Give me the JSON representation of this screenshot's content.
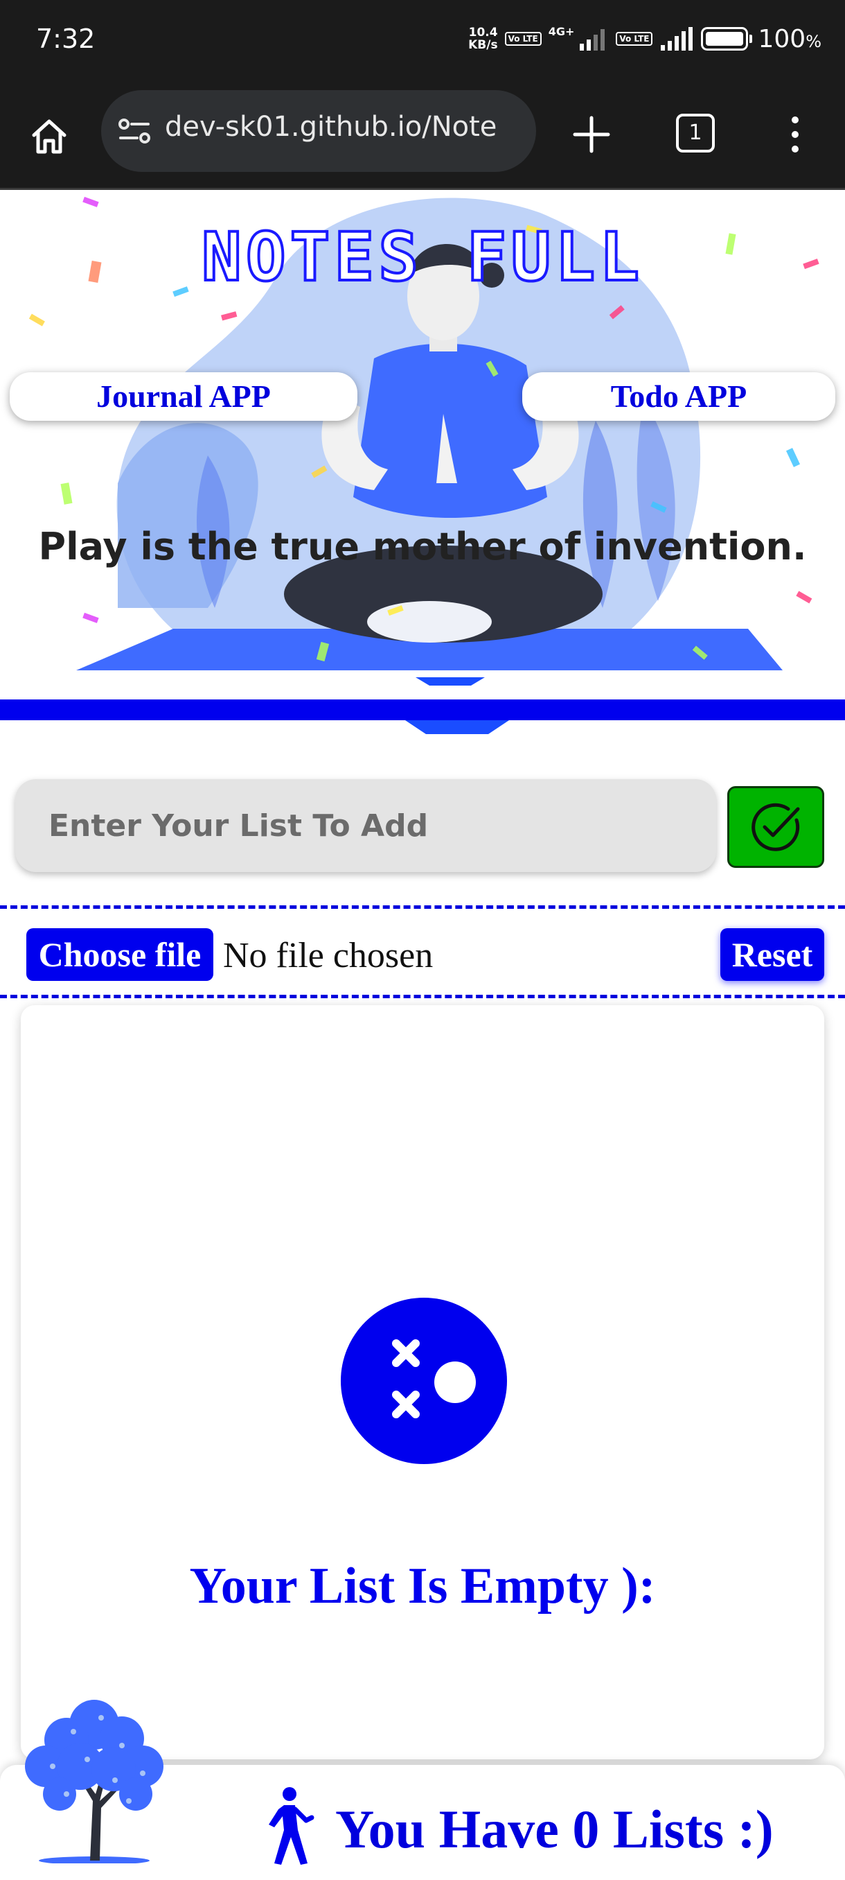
{
  "status_bar": {
    "time": "7:32",
    "net_speed_value": "10.4",
    "net_speed_unit": "KB/s",
    "volte_label_1": "Vo LTE",
    "network_type": "4G+",
    "volte_label_2": "Vo LTE",
    "battery_percent": "100",
    "battery_unit": "%",
    "battery_level": 1.0
  },
  "browser": {
    "url": "dev-sk01.github.io/Note",
    "tab_count": "1",
    "icons": [
      "home-icon",
      "site-info-icon",
      "new-tab-icon",
      "tabs-icon",
      "menu-icon"
    ]
  },
  "hero": {
    "title": "NOTES FULL",
    "nav_journal": "Journal APP",
    "nav_todo": "Todo APP",
    "quote": "Play is the true mother of invention."
  },
  "input": {
    "placeholder": "Enter Your List To Add",
    "value": ""
  },
  "file": {
    "choose_label": "Choose file",
    "status": "No file chosen",
    "reset_label": "Reset"
  },
  "empty_state": {
    "message": "Your List Is Empty ):"
  },
  "footer": {
    "count_text": "You Have 0 Lists :)"
  },
  "colors": {
    "accent_blue": "#0000ee",
    "add_button_green": "#00b300",
    "status_bar_bg": "#1b1b1b",
    "url_box_bg": "#2e3033"
  }
}
